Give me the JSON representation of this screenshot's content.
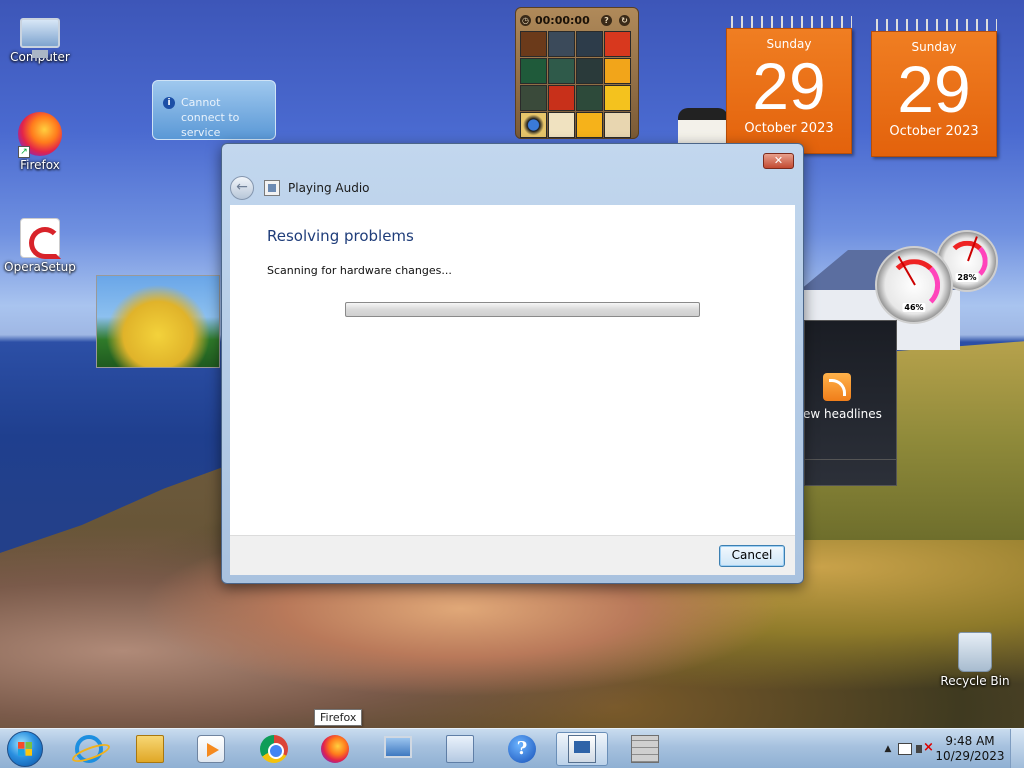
{
  "desktop": {
    "icons": [
      {
        "label": "Computer",
        "icon": "computer-icon"
      },
      {
        "label": "Firefox",
        "icon": "firefox-icon"
      },
      {
        "label": "OperaSetup",
        "icon": "opera-icon"
      },
      {
        "label": "Recycle Bin",
        "icon": "recycle-bin-icon"
      }
    ]
  },
  "gadgets": {
    "notification": {
      "text": "Cannot connect to service"
    },
    "puzzle": {
      "timer": "00:00:00"
    },
    "calendars": [
      {
        "day_of_week": "Sunday",
        "day": "29",
        "month_year": "October 2023"
      },
      {
        "day_of_week": "Sunday",
        "day": "29",
        "month_year": "October 2023"
      }
    ],
    "cpu_meter": {
      "cpu": "46%",
      "memory": "28%"
    },
    "feed": {
      "text": "ew headlines"
    }
  },
  "dialog": {
    "title": "Playing Audio",
    "close_label": "✕",
    "heading": "Resolving problems",
    "status": "Scanning for hardware changes...",
    "progress": 0,
    "cancel_label": "Cancel"
  },
  "taskbar": {
    "items": [
      {
        "name": "internet-explorer",
        "icon": "internet-explorer-icon"
      },
      {
        "name": "windows-explorer",
        "icon": "folder-icon"
      },
      {
        "name": "media-player",
        "icon": "media-player-icon"
      },
      {
        "name": "chrome",
        "icon": "chrome-icon"
      },
      {
        "name": "firefox",
        "icon": "firefox-icon"
      },
      {
        "name": "display",
        "icon": "display-icon"
      },
      {
        "name": "control-panel",
        "icon": "control-panel-icon"
      },
      {
        "name": "help",
        "icon": "help-icon"
      },
      {
        "name": "troubleshooting",
        "icon": "troubleshooting-icon"
      },
      {
        "name": "firewall",
        "icon": "firewall-icon"
      }
    ],
    "tooltip": "Firefox",
    "help_glyph": "?",
    "tray": {
      "chevron": "▲"
    },
    "clock": {
      "time": "9:48 AM",
      "date": "10/29/2023"
    }
  },
  "colors": {
    "calendar_orange": "#e3620c",
    "dialog_heading": "#1f3d7a",
    "taskbar": "#a6c1de"
  }
}
